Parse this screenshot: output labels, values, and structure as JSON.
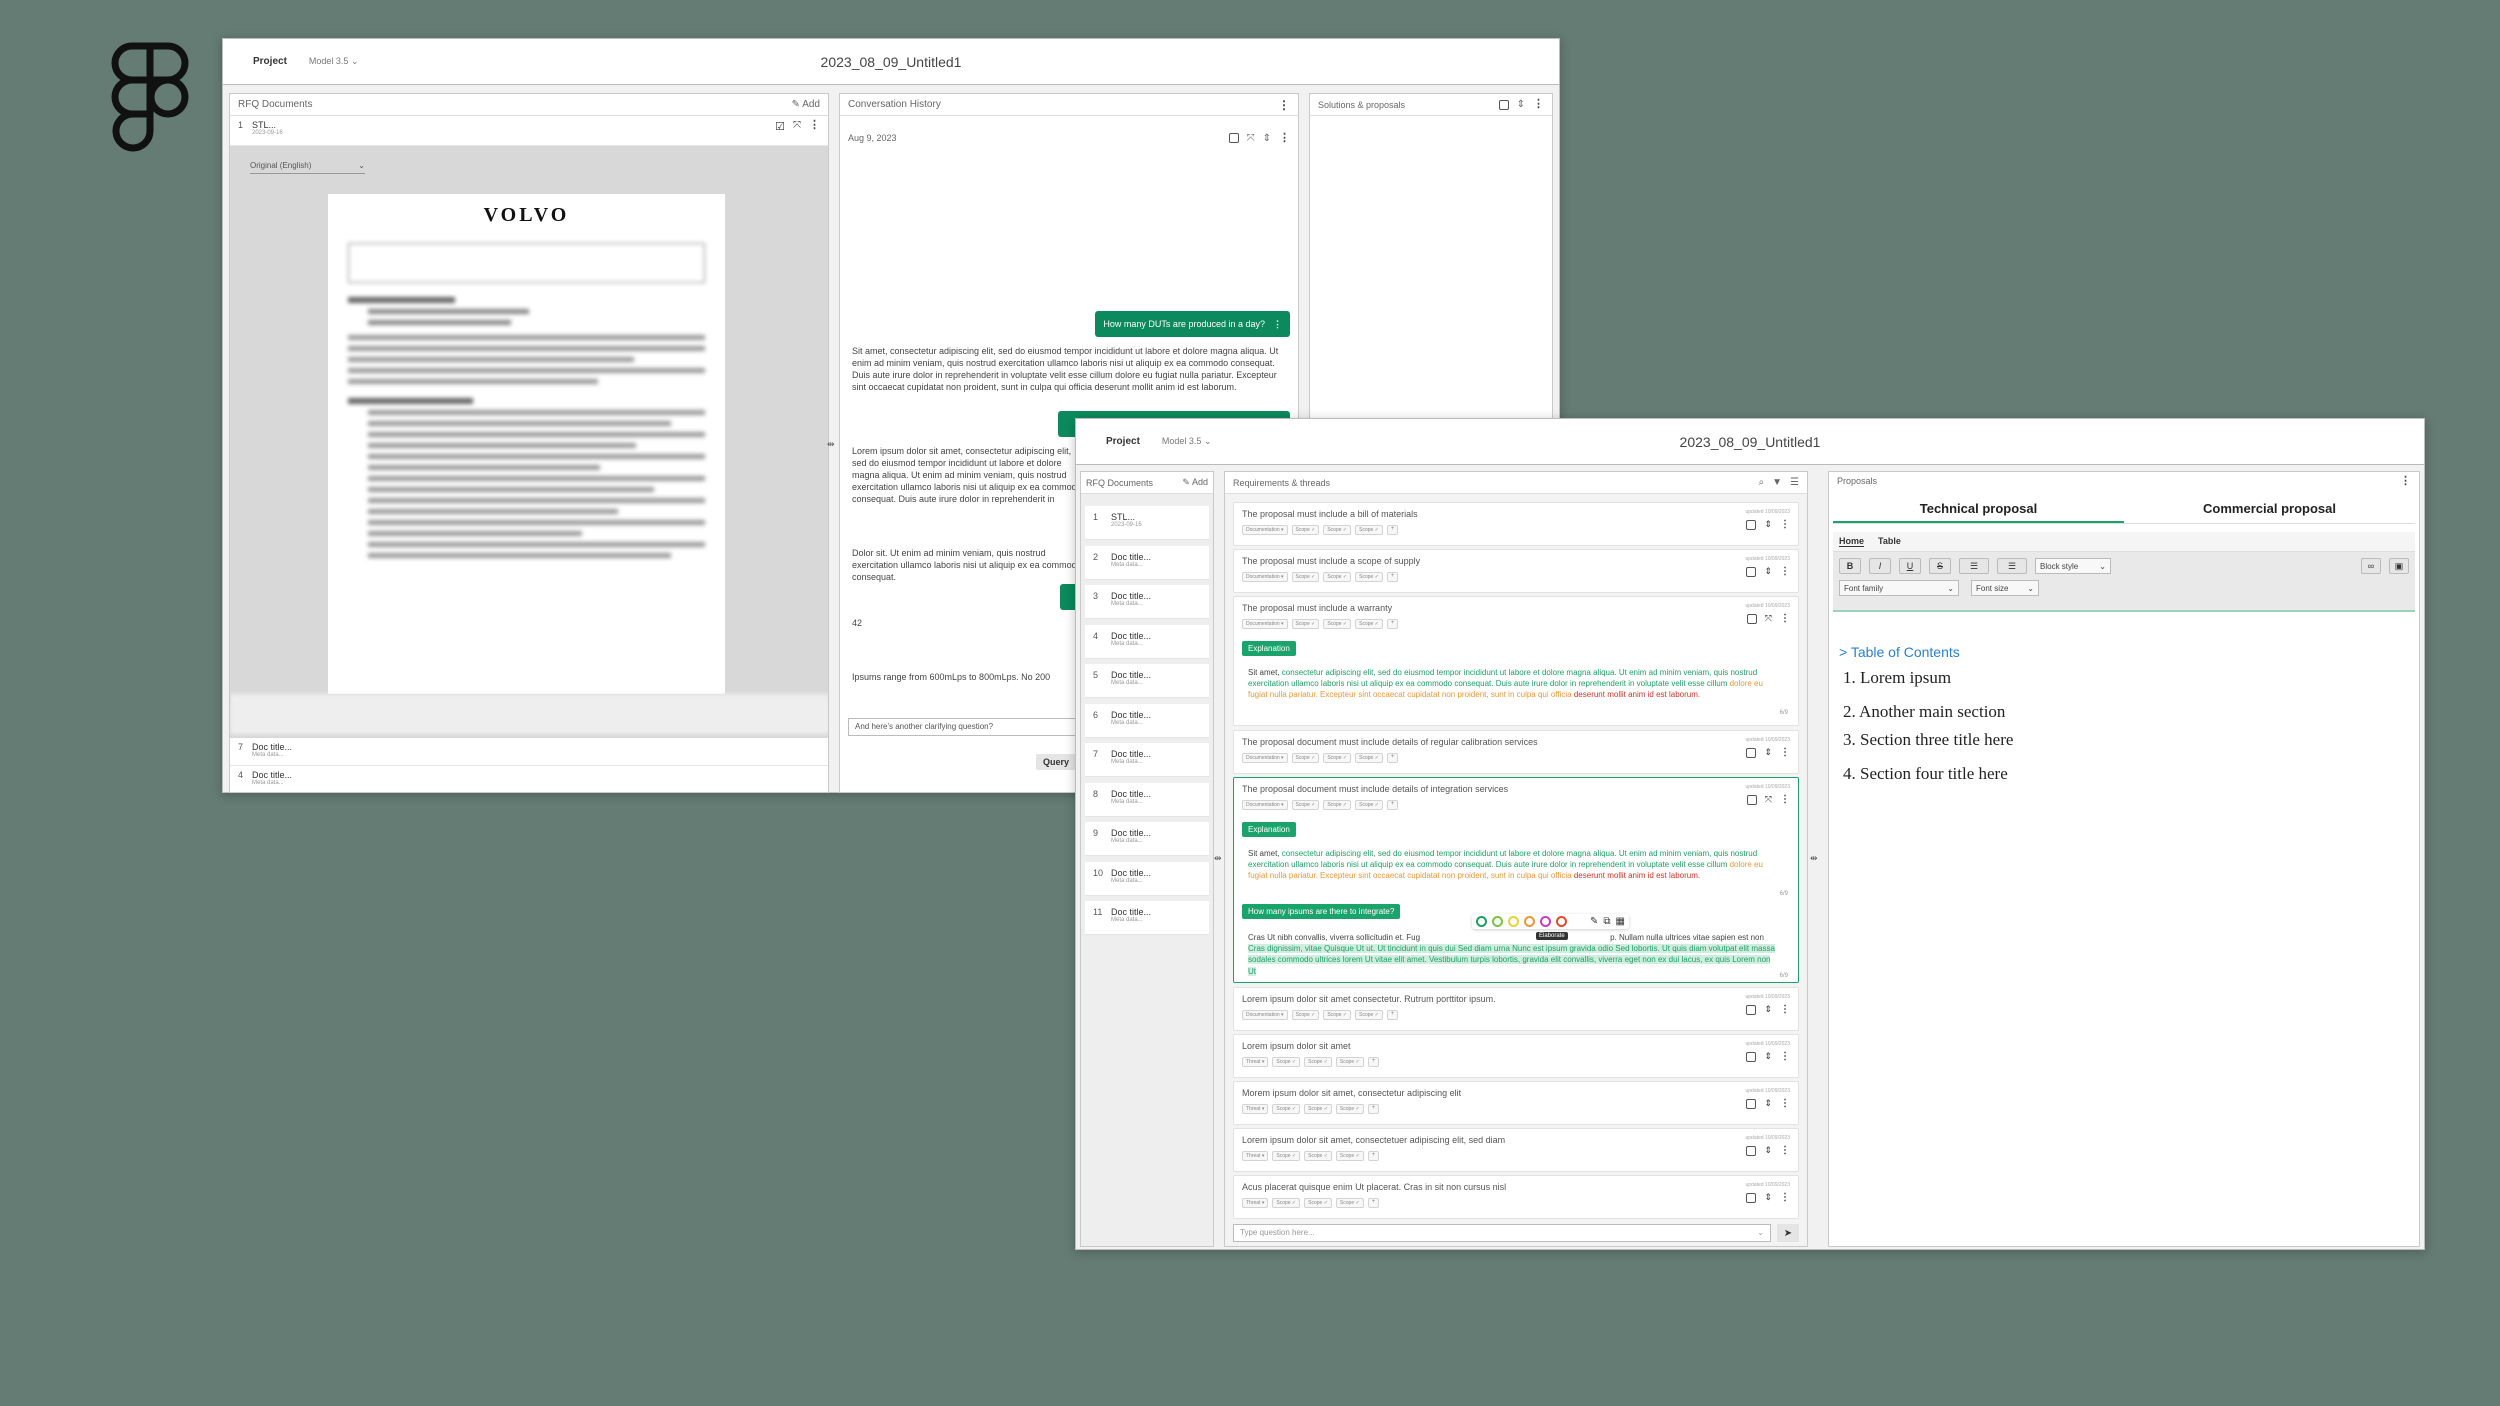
{
  "colors": {
    "background": "#647c74",
    "accent": "#0c8a5e",
    "highlight_green": "#1f9e63",
    "highlight_orange": "#e8983a",
    "highlight_red": "#d3322a",
    "toc_link": "#2a7fd0"
  },
  "logo": {
    "icon": "figma-logo"
  },
  "back": {
    "topbar": {
      "project": "Project",
      "model": "Model 3.5",
      "title": "2023_08_09_Untitled1"
    },
    "documents": {
      "title": "RFQ Documents",
      "add": "Add",
      "first": {
        "num": "1",
        "title": "STL...",
        "meta": "2023-09-16"
      },
      "language": "Original (English)",
      "brand": "VOLVO",
      "items": [
        {
          "num": "7",
          "title": "Doc title...",
          "meta": "Meta data..."
        },
        {
          "num": "4",
          "title": "Doc title...",
          "meta": "Meta data..."
        }
      ]
    },
    "conversation": {
      "title": "Conversation History",
      "date": "Aug 9, 2023",
      "question1": "How many DUTs are produced in a day?",
      "answer1": "Sit amet, consectetur adipiscing elit, sed do eiusmod tempor incididunt ut labore et dolore magna aliqua. Ut enim ad minim veniam, quis nostrud exercitation ullamco laboris nisi ut aliquip ex ea commodo consequat. Duis aute irure dolor in reprehenderit in voluptate velit esse cillum dolore eu fugiat nulla pariatur. Excepteur sint occaecat cupidatat non proident, sunt in culpa qui officia deserunt mollit anim id est laborum.",
      "answer2": "Lorem ipsum dolor sit amet, consectetur adipiscing elit, sed do eiusmod tempor incididunt ut labore et dolore magna aliqua. Ut enim ad minim veniam, quis nostrud exercitation ullamco laboris nisi ut aliquip ex ea commodo consequat. Duis aute irure dolor in reprehenderit in voluptate velit esse cillum dolore eu fugiat nulla pariatur. Excepteur sint occaecat cupidatat non proident, sunt in culpa qui officia deserunt mollit anim id est laborum.",
      "answer3": "Dolor sit. Ut enim ad minim veniam, quis nostrud exercitation ullamco laboris nisi ut aliquip ex ea commodo consequat.",
      "answer4": "42",
      "answer5": "Ipsums range from 600mLps to 800mLps. No 200",
      "input_value": "And here's another clarifying question?",
      "query": "Query"
    },
    "solutions": {
      "title": "Solutions & proposals"
    }
  },
  "front": {
    "topbar": {
      "project": "Project",
      "model": "Model 3.5",
      "title": "2023_08_09_Untitled1"
    },
    "documents": {
      "title": "RFQ Documents",
      "add": "Add",
      "items": [
        {
          "num": "1",
          "title": "STL...",
          "meta": "2023-09-16"
        },
        {
          "num": "2",
          "title": "Doc title...",
          "meta": "Meta data..."
        },
        {
          "num": "3",
          "title": "Doc title...",
          "meta": "Meta data..."
        },
        {
          "num": "4",
          "title": "Doc title...",
          "meta": "Meta data..."
        },
        {
          "num": "5",
          "title": "Doc title...",
          "meta": "Meta data..."
        },
        {
          "num": "6",
          "title": "Doc title...",
          "meta": "Meta data..."
        },
        {
          "num": "7",
          "title": "Doc title...",
          "meta": "Meta data..."
        },
        {
          "num": "8",
          "title": "Doc title...",
          "meta": "Meta data..."
        },
        {
          "num": "9",
          "title": "Doc title...",
          "meta": "Meta data..."
        },
        {
          "num": "10",
          "title": "Doc title...",
          "meta": "Meta data..."
        },
        {
          "num": "11",
          "title": "Doc title...",
          "meta": "Meta data..."
        }
      ]
    },
    "requirements": {
      "title": "Requirements & threads",
      "updated": "updated 10/09/2023",
      "chip_doc": "Documentation",
      "chip_threat": "Threat",
      "chip_scope": "Scope",
      "chip_add": "+",
      "items": [
        "The proposal must include a bill of materials",
        "The proposal must include a scope of supply",
        "The proposal must include a warranty",
        "The proposal document must include details of regular calibration services",
        "The proposal document must include details of integration services",
        "Lorem ipsum dolor sit amet consectetur. Rutrum porttitor ipsum.",
        "Lorem ipsum dolor sit amet",
        "Morem ipsum dolor sit amet, consectetur adipiscing elit",
        "Lorem ipsum dolor sit amet, consectetuer adipiscing elit, sed diam",
        "Acus placerat quisque enim Ut placerat. Cras in sit non cursus nisl"
      ],
      "explanation": "Explanation",
      "expl_a": "Sit amet, ",
      "expl_b": "consectetur adipiscing elit, sed do eiusmod tempor incididunt ut labore et dolore magna aliqua. Ut enim ad minim veniam, quis nostrud exercitation ullamco laboris nisi ut aliquip ex ea commodo consequat. Duis aute irure dolor in reprehenderit in voluptate velit esse cillum ",
      "expl_c": "dolore eu fugiat nulla pariatur. Excepteur sint occaecat cupidatat non proident, sunt in culpa qui officia ",
      "expl_d": "deserunt mollit anim id est laborum.",
      "page": "6/9",
      "question": "How many ipsums are there to integrate?",
      "answer_a": "Cras Ut nibh convallis, viverra sollicitudin et. Fug",
      "answer_b": "p. Nullam nulla ultrices vitae sapien est non ",
      "answer_c": "Cras dignissim, vitae Quisque Ut ut. Ut tincidunt in quis dui Sed diam urna Nunc est ipsum gravida odio Sed lobortis. Ut quis diam volutpat elit massa sodales commodo ultrices lorem Ut vitae elit amet. Vestibulum turpis lobortis, gravida elit convallis, viverra eget non ex dui lacus, ex quis Lorem non Ut",
      "tooltip": "Elaborate",
      "input_placeholder": "Type question here..."
    },
    "proposals": {
      "title": "Proposals",
      "tab1": "Technical proposal",
      "tab2": "Commercial proposal",
      "subtab1": "Home",
      "subtab2": "Table",
      "bold": "B",
      "italic": "I",
      "underline": "U",
      "strike": "S",
      "block_style": "Block style",
      "font_family": "Font family",
      "font_size": "Font size",
      "toc_link": "> Table of Contents",
      "toc": [
        "1.  Lorem ipsum",
        "2.  Another main section",
        "3.  Section three title here",
        "4.  Section four title here"
      ]
    }
  }
}
